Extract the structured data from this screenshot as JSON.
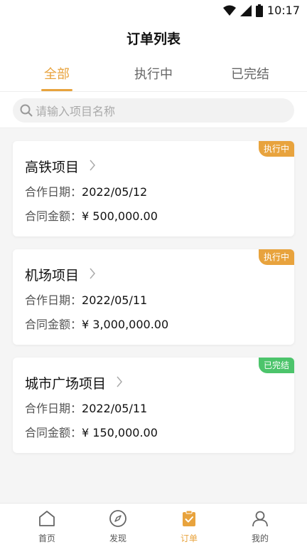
{
  "status": {
    "time": "10:17"
  },
  "header": {
    "title": "订单列表"
  },
  "tabs": [
    {
      "label": "全部"
    },
    {
      "label": "执行中"
    },
    {
      "label": "已完结"
    }
  ],
  "search": {
    "placeholder": "请输入项目名称"
  },
  "orders": [
    {
      "name": "高铁项目",
      "date_label": "合作日期：",
      "date": "2022/05/12",
      "amount_label": "合同金额：",
      "amount": "¥ 500,000.00",
      "status": "执行中",
      "status_color": "#e8a33d"
    },
    {
      "name": "机场项目",
      "date_label": "合作日期：",
      "date": "2022/05/11",
      "amount_label": "合同金额：",
      "amount": "¥ 3,000,000.00",
      "status": "执行中",
      "status_color": "#e8a33d"
    },
    {
      "name": "城市广场项目",
      "date_label": "合作日期：",
      "date": "2022/05/11",
      "amount_label": "合同金额：",
      "amount": "¥ 150,000.00",
      "status": "已完结",
      "status_color": "#4cc46b"
    }
  ],
  "tabbar": [
    {
      "label": "首页",
      "icon": "home-icon"
    },
    {
      "label": "发现",
      "icon": "compass-icon"
    },
    {
      "label": "订单",
      "icon": "clipboard-check-icon"
    },
    {
      "label": "我的",
      "icon": "user-icon"
    }
  ],
  "colors": {
    "accent": "#e8a33d",
    "done": "#4cc46b"
  }
}
